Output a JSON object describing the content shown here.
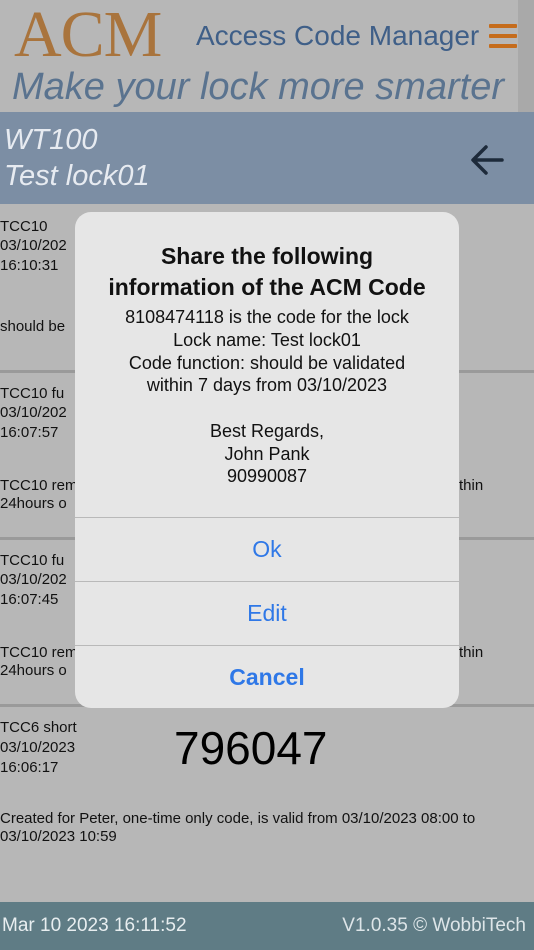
{
  "header": {
    "logo": "ACM",
    "app_title": "Access Code Manager",
    "tagline": "Make your lock more smarter"
  },
  "lock": {
    "model": "WT100",
    "name": "Test lock01"
  },
  "codes": [
    {
      "name": "TCC10",
      "date": "03/10/202",
      "time": "16:10:31",
      "description": "should be"
    },
    {
      "name": "TCC10 fu",
      "date": "03/10/202",
      "time": "16:07:57",
      "description_line1": "TCC10 rem",
      "description_line1_tail": "thin",
      "description_line2": "24hours o"
    },
    {
      "name": "TCC10 fu",
      "date": "03/10/202",
      "time": "16:07:45",
      "description_line1": "TCC10 rem",
      "description_line1_tail": "thin",
      "description_line2": "24hours o"
    },
    {
      "name": "TCC6 short",
      "date": "03/10/2023",
      "time": "16:06:17",
      "code": "796047",
      "description_line1": "Created for Peter, one-time only code, is valid from 03/10/2023 08:00 to",
      "description_line2": "03/10/2023 10:59"
    }
  ],
  "footer": {
    "datetime": "Mar 10 2023 16:11:52",
    "version": "V1.0.35 © WobbiTech"
  },
  "dialog": {
    "title_line1": "Share the following",
    "title_line2": "information of the ACM Code",
    "message_lines": [
      "8108474118 is the code for the lock",
      "Lock name: Test lock01",
      "Code function: should be validated",
      "within 7 days from 03/10/2023",
      "",
      "Best Regards,",
      "John Pank",
      "90990087"
    ],
    "buttons": {
      "ok": "Ok",
      "edit": "Edit",
      "cancel": "Cancel"
    }
  },
  "colors": {
    "logo": "#a9743d",
    "menu_icon": "#c56c1c",
    "lock_bar": "#7c8ea4",
    "footer": "#5f7c85",
    "dialog_button": "#2f78e7"
  },
  "icons": {
    "menu": "hamburger-menu-icon",
    "back": "arrow-left-icon"
  }
}
